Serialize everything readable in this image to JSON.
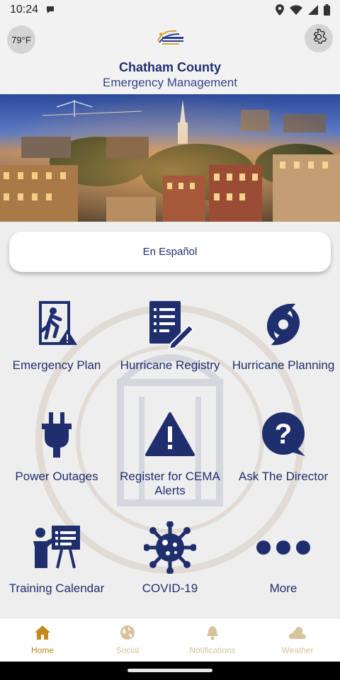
{
  "status_bar": {
    "time": "10:24"
  },
  "header": {
    "temperature": "79°F",
    "title": "Chatham County",
    "subtitle": "Emergency Management"
  },
  "espanol_button": "En Español",
  "tiles": [
    {
      "label": "Emergency Plan",
      "icon": "emergency-exit-icon"
    },
    {
      "label": "Hurricane Registry",
      "icon": "registry-document-icon"
    },
    {
      "label": "Hurricane Planning",
      "icon": "hurricane-icon"
    },
    {
      "label": "Power Outages",
      "icon": "power-plug-icon"
    },
    {
      "label": "Register for CEMA Alerts",
      "icon": "warning-triangle-icon"
    },
    {
      "label": "Ask The Director",
      "icon": "question-bubble-icon"
    },
    {
      "label": "Training Calendar",
      "icon": "presentation-icon"
    },
    {
      "label": "COVID-19",
      "icon": "virus-icon"
    },
    {
      "label": "More",
      "icon": "more-dots-icon"
    }
  ],
  "bottom_nav": [
    {
      "label": "Home",
      "icon": "home-icon",
      "active": true
    },
    {
      "label": "Social",
      "icon": "globe-icon",
      "active": false
    },
    {
      "label": "Notifications",
      "icon": "bell-icon",
      "active": false
    },
    {
      "label": "Weather",
      "icon": "weather-icon",
      "active": false
    }
  ],
  "colors": {
    "primary": "#1f2f6e",
    "accent": "#c08a1e",
    "accent_muted": "#d7c39b",
    "background": "#efeeee"
  }
}
